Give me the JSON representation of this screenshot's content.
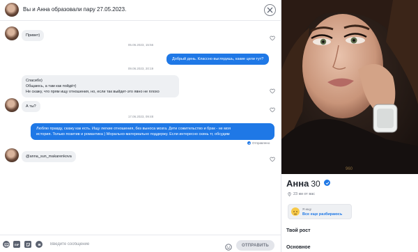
{
  "header": {
    "title": "Вы и Анна образовали пару 27.05.2023."
  },
  "messages": [
    {
      "direction": "in",
      "text": "Привет)"
    },
    {
      "type": "date",
      "text": "05.06.2023, 15:56"
    },
    {
      "direction": "out",
      "text": "Добрый день. Классно выглядишь, какие цели тут?"
    },
    {
      "type": "date",
      "text": "09.06.2023, 20:19"
    },
    {
      "direction": "in",
      "lines": [
        "Спасибо)",
        "Общаюсь, а там как пойдёт)",
        "Не скажу, что прям ищу отношения, но, если так выйдет-это явно не плохо"
      ]
    },
    {
      "direction": "in",
      "text": "А ты?"
    },
    {
      "type": "date",
      "text": "17.06.2023, 09:48"
    },
    {
      "direction": "out",
      "lines": [
        "Люблю правду, скажу как есть. Ищу легкие отношения, без выноса мозга. Дети сожительство и брак - не моя",
        "история. Только позитив и романтика ) Морально-материально поддержу. Если интересно скинь тг, обсудим"
      ]
    },
    {
      "direction": "in",
      "text": "@anna_sun_makarenkova"
    }
  ],
  "status": {
    "sent": "Отправлено"
  },
  "composer": {
    "placeholder": "Введите сообщение",
    "send_label": "ОТПРАВИТЬ",
    "tools": [
      "gallery-icon",
      "gif-icon",
      "sticker-icon",
      "menu-icon"
    ]
  },
  "profile": {
    "name": "Анна",
    "age": "30",
    "distance": "23 км от вас",
    "looking_for": {
      "label": "Я ищу",
      "value": "Все еще разбираюсь"
    },
    "sections": [
      "Твой рост",
      "Основное"
    ]
  },
  "colors": {
    "accent": "#1f78e6",
    "bubble_in": "#eef0f3",
    "text": "#21262e"
  }
}
